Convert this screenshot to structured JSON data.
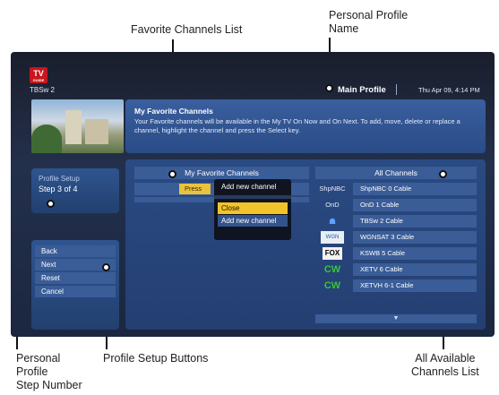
{
  "callouts": {
    "favorite_list": "Favorite Channels List",
    "profile_name_line1": "Personal Profile",
    "profile_name_line2": "Name",
    "step_line1": "Personal",
    "step_line2": "Profile",
    "step_line3": "Step Number",
    "setup_buttons": "Profile Setup Buttons",
    "all_channels_line1": "All Available",
    "all_channels_line2": "Channels List"
  },
  "header": {
    "logo_top": "TV",
    "logo_bottom": "GUIDE",
    "channel": "TBSw 2",
    "profile_name": "Main Profile",
    "datetime": "Thu Apr 09, 4:14 PM"
  },
  "description": {
    "title": "My Favorite Channels",
    "text": "Your Favorite channels will be available in the My TV On Now and On Next. To add, move, delete or replace a channel, highlight the channel and press the Select key."
  },
  "favorites": {
    "header": "My Favorite Channels",
    "press_text": "Press"
  },
  "popup": {
    "title": "Add new channel",
    "options": [
      "Close",
      "Add new channel"
    ],
    "selected": "Close"
  },
  "all_channels": {
    "header": "All Channels",
    "items": [
      {
        "logo": "ShpNBC",
        "logo_icon": "text",
        "name": "ShpNBC 0 Cable"
      },
      {
        "logo": "OnD",
        "logo_icon": "text",
        "name": "OnD 1 Cable"
      },
      {
        "logo": "☗",
        "logo_icon": "tbs-icon",
        "name": "TBSw 2 Cable"
      },
      {
        "logo": "WGN",
        "logo_icon": "wgn-icon",
        "name": "WGNSAT 3 Cable"
      },
      {
        "logo": "FOX",
        "logo_icon": "fox-icon",
        "name": "KSWB 5 Cable"
      },
      {
        "logo": "CW",
        "logo_icon": "cw-icon",
        "name": "XETV 6 Cable"
      },
      {
        "logo": "CW",
        "logo_icon": "cw-icon",
        "name": "XETVH 6-1 Cable"
      }
    ],
    "more_indicator": "▼"
  },
  "profile_setup": {
    "label": "Profile Setup",
    "step": "Step 3 of 4"
  },
  "setup_buttons": [
    "Back",
    "Next",
    "Reset",
    "Cancel"
  ],
  "colors": {
    "panel": "#2a4a82",
    "row": "#3a5d98",
    "highlight": "#f2c42c",
    "press_highlight": "#e9c23e"
  }
}
